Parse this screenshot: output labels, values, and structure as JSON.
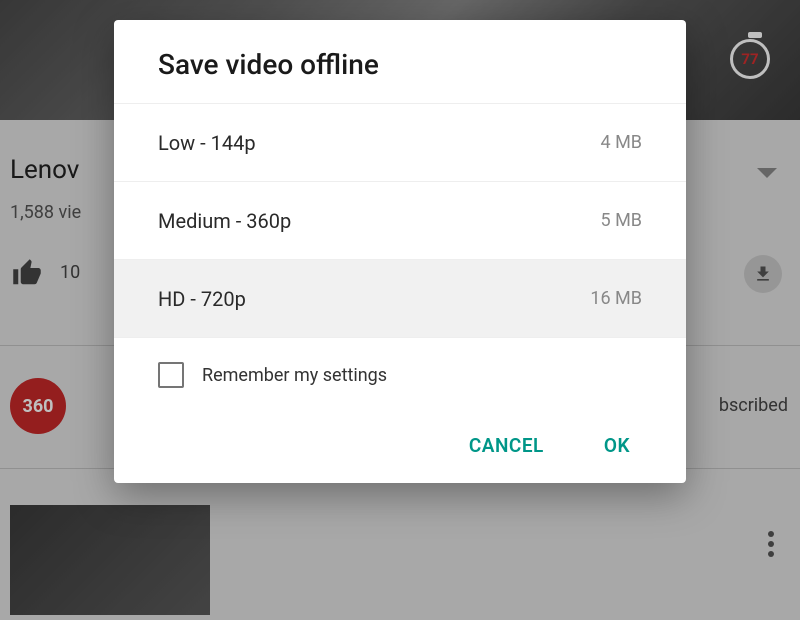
{
  "background": {
    "video_title_partial": "Lenov",
    "views_partial": "1,588 vie",
    "like_count": "10",
    "channel_badge": "360",
    "subscribed_partial": "bscribed",
    "timer_value": "77"
  },
  "dialog": {
    "title": "Save video offline",
    "options": [
      {
        "label": "Low - 144p",
        "size": "4 MB",
        "selected": false
      },
      {
        "label": "Medium - 360p",
        "size": "5 MB",
        "selected": false
      },
      {
        "label": "HD - 720p",
        "size": "16 MB",
        "selected": true
      }
    ],
    "remember_label": "Remember my settings",
    "remember_checked": false,
    "cancel_label": "CANCEL",
    "ok_label": "OK"
  }
}
